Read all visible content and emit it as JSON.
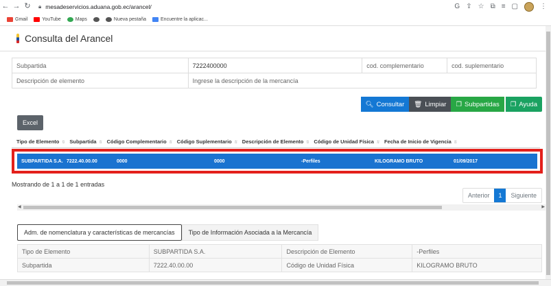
{
  "browser": {
    "url": "mesadeservicios.aduana.gob.ec/arancel/",
    "bookmarks": [
      {
        "label": "Gmail",
        "color": "#ea4335"
      },
      {
        "label": "YouTube",
        "color": "#ff0000"
      },
      {
        "label": "Maps",
        "color": "#34a853"
      },
      {
        "label": "",
        "color": "#555555"
      },
      {
        "label": "Nueva pestaña",
        "color": "#555555"
      },
      {
        "label": "Encuentre la aplicac...",
        "color": "#4285f4"
      }
    ]
  },
  "app": {
    "title": "Consulta del Arancel"
  },
  "form": {
    "subpartida_label": "Subpartida",
    "subpartida_value": "7222400000",
    "cod_complementario": "cod. complementario",
    "cod_suplementario": "cod. suplementario",
    "descripcion_label": "Descripción de elemento",
    "descripcion_placeholder": "Ingrese la descripción de la mercancía"
  },
  "buttons": {
    "consultar": "Consultar",
    "limpiar": "Limpiar",
    "subpartidas": "Subpartidas",
    "ayuda": "Ayuda",
    "excel": "Excel"
  },
  "results": {
    "columns": [
      "Tipo de Elemento",
      "Subpartida",
      "Código Complementario",
      "Código Suplementario",
      "Descripción de Elemento",
      "Código de Unidad Física",
      "Fecha de Inicio de Vigencia"
    ],
    "row": {
      "tipo": "SUBPARTIDA S.A.",
      "subpartida": "7222.40.00.00",
      "complementario": "0000",
      "suplementario": "0000",
      "descripcion": "-Perfiles",
      "unidad": "KILOGRAMO BRUTO",
      "fecha": "01/09/2017"
    },
    "showing": "Mostrando de 1 a 1 de 1 entradas"
  },
  "pager": {
    "prev": "Anterior",
    "page": "1",
    "next": "Siguiente"
  },
  "tabs": [
    {
      "label": "Adm. de nomenclatura y características de mercancías"
    },
    {
      "label": "Tipo de Información Asociada a la Mercancía"
    }
  ],
  "detail": {
    "rows": [
      {
        "k1": "Tipo de Elemento",
        "v1": "SUBPARTIDA S.A.",
        "k2": "Descripción de Elemento",
        "v2": "-Perfiles"
      },
      {
        "k1": "Subpartida",
        "v1": "7222.40.00.00",
        "k2": "Código de Unidad Física",
        "v2": "KILOGRAMO BRUTO"
      }
    ]
  },
  "colors": {
    "primary": "#1478d4",
    "success": "#28a745",
    "highlight": "#e3201b"
  }
}
